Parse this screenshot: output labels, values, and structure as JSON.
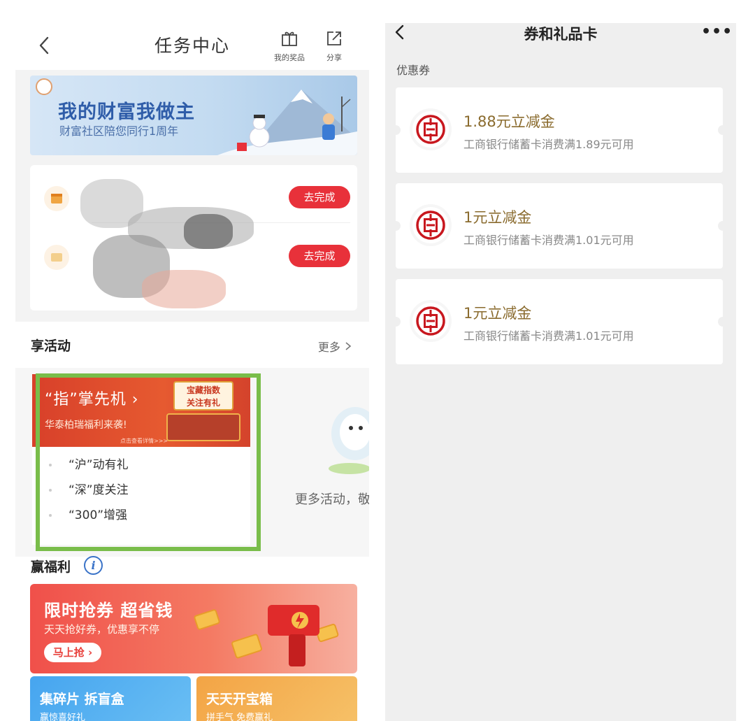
{
  "left": {
    "header": {
      "title": "任务中心",
      "prize_label": "我的奖品",
      "share_label": "分享"
    },
    "banner": {
      "title": "我的财富我做主",
      "subtitle": "财富社区陪您同行1周年"
    },
    "tasks": [
      {
        "button": "去完成"
      },
      {
        "button": "去完成"
      }
    ],
    "activities": {
      "heading": "享活动",
      "more": "更多",
      "card": {
        "title": "“指”掌先机",
        "subtitle": "华泰柏瑞福利来袭!",
        "sign_line1": "宝藏指数",
        "sign_line2": "关注有礼",
        "tiny_note": "点击查看详情>>>",
        "items": [
          "“沪”动有礼",
          "“深”度关注",
          "“300”增强"
        ]
      },
      "more_text": "更多活动，敬"
    },
    "benefits": {
      "heading": "赢福利",
      "promo": {
        "title": "限时抢券 超省钱",
        "subtitle": "天天抢好券，优惠享不停",
        "button": "马上抢"
      },
      "tiles": [
        {
          "title": "集碎片 拆盲盒",
          "subtitle": "赢惊喜好礼"
        },
        {
          "title": "天天开宝箱",
          "subtitle": "拼手气 免费赢礼"
        }
      ]
    }
  },
  "right": {
    "header": {
      "title": "券和礼品卡",
      "more": "•••"
    },
    "section": "优惠券",
    "coupons": [
      {
        "title": "1.88元立减金",
        "desc": "工商银行储蓄卡消费满1.89元可用"
      },
      {
        "title": "1元立减金",
        "desc": "工商银行储蓄卡消费满1.01元可用"
      },
      {
        "title": "1元立减金",
        "desc": "工商银行储蓄卡消费满1.01元可用"
      }
    ]
  },
  "colors": {
    "task_button": "#e8313a",
    "highlight_frame": "#79bd4a",
    "icbc_red": "#c8171e",
    "coupon_title": "#8a6b2e",
    "right_background": "#efefef"
  },
  "icons": [
    "back-icon",
    "gift-icon",
    "share-icon",
    "calendar-icon",
    "info-icon",
    "icbc-logo",
    "more-icon",
    "chevron-right-icon"
  ]
}
